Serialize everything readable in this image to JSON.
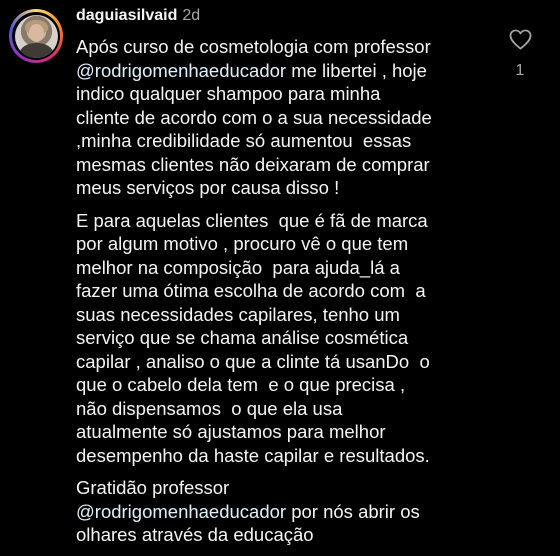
{
  "comment": {
    "username": "daguiasilvaid",
    "time_ago": "2d",
    "like_count": "1",
    "icons": {
      "avatar": "profile-photo",
      "like": "heart-outline-icon"
    },
    "colors": {
      "background": "#000000",
      "text": "#f5f5f5",
      "secondary_text": "#a8a8a8",
      "mention": "#e0f1ff"
    },
    "paragraphs": [
      [
        "Após curso de cosmetologia com professor",
        "@rodrigomenhaeducador me libertei , hoje",
        "indico qualquer shampoo para minha",
        "cliente de acordo com o a sua necessidade",
        ",minha credibilidade só aumentou  essas",
        "mesmas clientes não deixaram de comprar",
        "meus serviços por causa disso !"
      ],
      [
        "E para aquelas clientes  que é fã de marca",
        "por algum motivo , procuro vê o que tem",
        "melhor na composição  para ajuda_lá a",
        "fazer uma ótima escolha de acordo com  a",
        "suas necessidades capilares, tenho um",
        "serviço que se chama análise cosmética",
        "capilar , analiso o que a clinte tá usanDo  o",
        "que o cabelo dela tem  e o que precisa ,",
        "não dispensamos  o que ela usa",
        "atualmente só ajustamos para melhor",
        "desempenho da haste capilar e resultados."
      ],
      [
        "Gratidão professor",
        "@rodrigomenhaeducador por nós abrir os",
        "olhares através da educação"
      ]
    ]
  }
}
